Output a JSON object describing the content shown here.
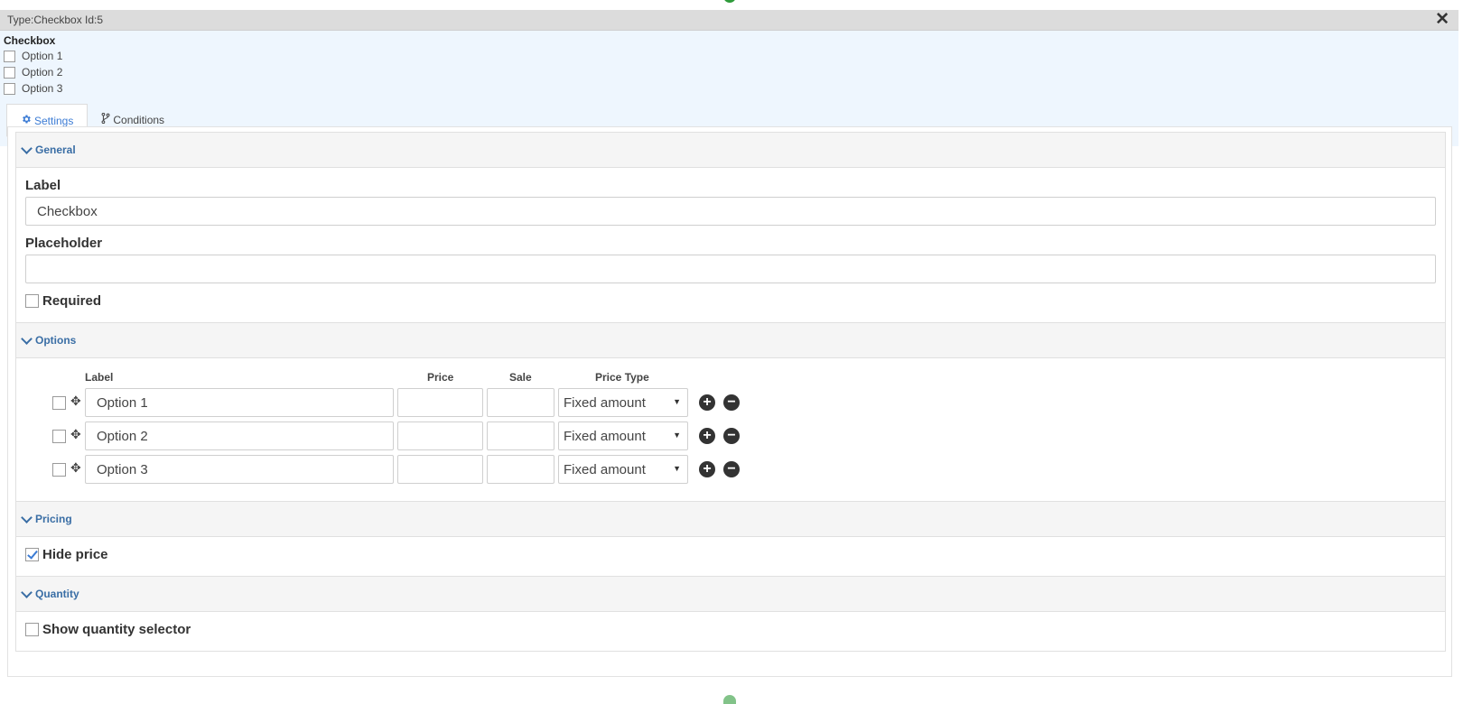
{
  "window": {
    "title": "Type:Checkbox Id:5",
    "close_label": "✕"
  },
  "preview": {
    "title": "Checkbox",
    "options": [
      "Option 1",
      "Option 2",
      "Option 3"
    ]
  },
  "tabs": {
    "settings": "Settings",
    "conditions": "Conditions"
  },
  "general": {
    "header": "General",
    "label_label": "Label",
    "label_value": "Checkbox",
    "placeholder_label": "Placeholder",
    "placeholder_value": "",
    "required_label": "Required",
    "required_checked": false
  },
  "options": {
    "header": "Options",
    "columns": {
      "label": "Label",
      "price": "Price",
      "sale": "Sale",
      "price_type": "Price Type"
    },
    "rows": [
      {
        "label": "Option 1",
        "price": "",
        "sale": "",
        "price_type": "Fixed amount"
      },
      {
        "label": "Option 2",
        "price": "",
        "sale": "",
        "price_type": "Fixed amount"
      },
      {
        "label": "Option 3",
        "price": "",
        "sale": "",
        "price_type": "Fixed amount"
      }
    ]
  },
  "pricing": {
    "header": "Pricing",
    "hide_price_label": "Hide price",
    "hide_price_checked": true
  },
  "quantity": {
    "header": "Quantity",
    "show_selector_label": "Show quantity selector",
    "show_selector_checked": false
  },
  "colors": {
    "accent": "#3b7bd4",
    "section_header": "#3a6ea5",
    "preview_bg": "#eef6fe",
    "titlebar_bg": "#dcdcdc",
    "indicator": "#2e9b3a"
  },
  "icons": {
    "settings_tab": "gear-icon",
    "conditions_tab": "branch-icon",
    "close": "close-icon",
    "move": "move-icon",
    "add": "plus-circle-icon",
    "remove": "minus-circle-icon",
    "dropdown": "caret-down-icon",
    "collapse": "chevron-down-icon"
  }
}
